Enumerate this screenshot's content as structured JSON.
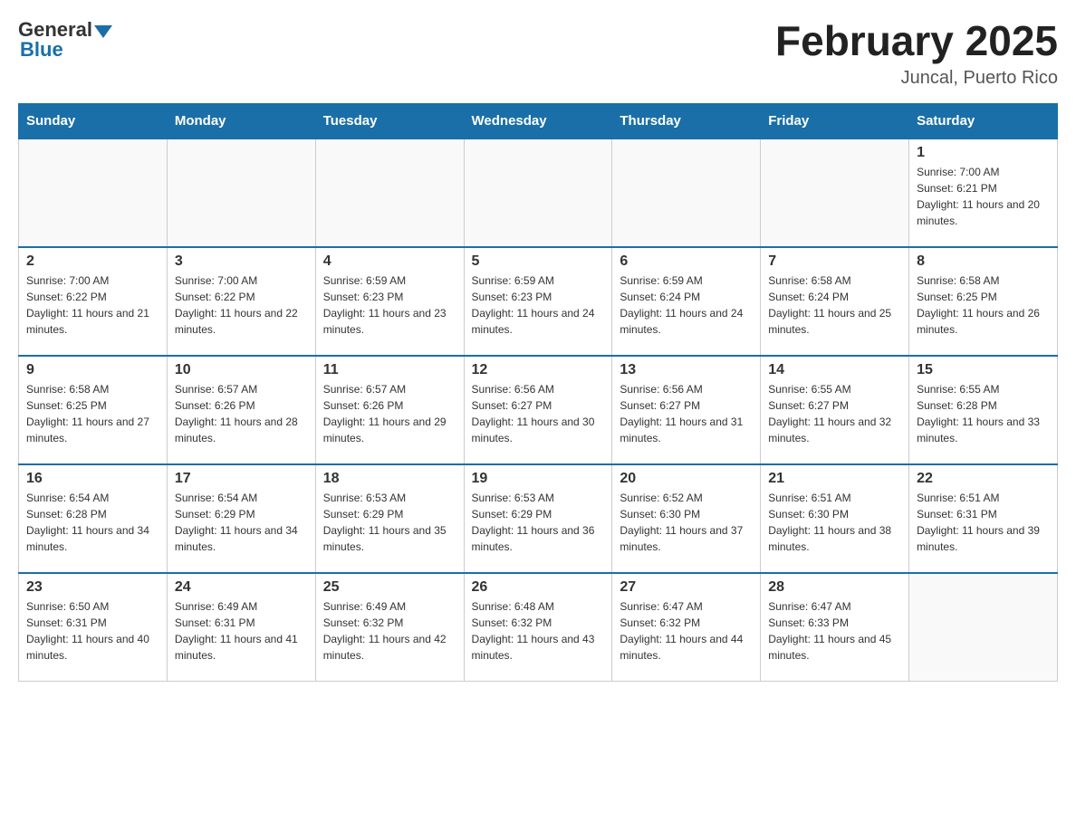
{
  "header": {
    "logo_general": "General",
    "logo_blue": "Blue",
    "title": "February 2025",
    "location": "Juncal, Puerto Rico"
  },
  "days_of_week": [
    "Sunday",
    "Monday",
    "Tuesday",
    "Wednesday",
    "Thursday",
    "Friday",
    "Saturday"
  ],
  "weeks": [
    [
      {
        "day": "",
        "sunrise": "",
        "sunset": "",
        "daylight": ""
      },
      {
        "day": "",
        "sunrise": "",
        "sunset": "",
        "daylight": ""
      },
      {
        "day": "",
        "sunrise": "",
        "sunset": "",
        "daylight": ""
      },
      {
        "day": "",
        "sunrise": "",
        "sunset": "",
        "daylight": ""
      },
      {
        "day": "",
        "sunrise": "",
        "sunset": "",
        "daylight": ""
      },
      {
        "day": "",
        "sunrise": "",
        "sunset": "",
        "daylight": ""
      },
      {
        "day": "1",
        "sunrise": "Sunrise: 7:00 AM",
        "sunset": "Sunset: 6:21 PM",
        "daylight": "Daylight: 11 hours and 20 minutes."
      }
    ],
    [
      {
        "day": "2",
        "sunrise": "Sunrise: 7:00 AM",
        "sunset": "Sunset: 6:22 PM",
        "daylight": "Daylight: 11 hours and 21 minutes."
      },
      {
        "day": "3",
        "sunrise": "Sunrise: 7:00 AM",
        "sunset": "Sunset: 6:22 PM",
        "daylight": "Daylight: 11 hours and 22 minutes."
      },
      {
        "day": "4",
        "sunrise": "Sunrise: 6:59 AM",
        "sunset": "Sunset: 6:23 PM",
        "daylight": "Daylight: 11 hours and 23 minutes."
      },
      {
        "day": "5",
        "sunrise": "Sunrise: 6:59 AM",
        "sunset": "Sunset: 6:23 PM",
        "daylight": "Daylight: 11 hours and 24 minutes."
      },
      {
        "day": "6",
        "sunrise": "Sunrise: 6:59 AM",
        "sunset": "Sunset: 6:24 PM",
        "daylight": "Daylight: 11 hours and 24 minutes."
      },
      {
        "day": "7",
        "sunrise": "Sunrise: 6:58 AM",
        "sunset": "Sunset: 6:24 PM",
        "daylight": "Daylight: 11 hours and 25 minutes."
      },
      {
        "day": "8",
        "sunrise": "Sunrise: 6:58 AM",
        "sunset": "Sunset: 6:25 PM",
        "daylight": "Daylight: 11 hours and 26 minutes."
      }
    ],
    [
      {
        "day": "9",
        "sunrise": "Sunrise: 6:58 AM",
        "sunset": "Sunset: 6:25 PM",
        "daylight": "Daylight: 11 hours and 27 minutes."
      },
      {
        "day": "10",
        "sunrise": "Sunrise: 6:57 AM",
        "sunset": "Sunset: 6:26 PM",
        "daylight": "Daylight: 11 hours and 28 minutes."
      },
      {
        "day": "11",
        "sunrise": "Sunrise: 6:57 AM",
        "sunset": "Sunset: 6:26 PM",
        "daylight": "Daylight: 11 hours and 29 minutes."
      },
      {
        "day": "12",
        "sunrise": "Sunrise: 6:56 AM",
        "sunset": "Sunset: 6:27 PM",
        "daylight": "Daylight: 11 hours and 30 minutes."
      },
      {
        "day": "13",
        "sunrise": "Sunrise: 6:56 AM",
        "sunset": "Sunset: 6:27 PM",
        "daylight": "Daylight: 11 hours and 31 minutes."
      },
      {
        "day": "14",
        "sunrise": "Sunrise: 6:55 AM",
        "sunset": "Sunset: 6:27 PM",
        "daylight": "Daylight: 11 hours and 32 minutes."
      },
      {
        "day": "15",
        "sunrise": "Sunrise: 6:55 AM",
        "sunset": "Sunset: 6:28 PM",
        "daylight": "Daylight: 11 hours and 33 minutes."
      }
    ],
    [
      {
        "day": "16",
        "sunrise": "Sunrise: 6:54 AM",
        "sunset": "Sunset: 6:28 PM",
        "daylight": "Daylight: 11 hours and 34 minutes."
      },
      {
        "day": "17",
        "sunrise": "Sunrise: 6:54 AM",
        "sunset": "Sunset: 6:29 PM",
        "daylight": "Daylight: 11 hours and 34 minutes."
      },
      {
        "day": "18",
        "sunrise": "Sunrise: 6:53 AM",
        "sunset": "Sunset: 6:29 PM",
        "daylight": "Daylight: 11 hours and 35 minutes."
      },
      {
        "day": "19",
        "sunrise": "Sunrise: 6:53 AM",
        "sunset": "Sunset: 6:29 PM",
        "daylight": "Daylight: 11 hours and 36 minutes."
      },
      {
        "day": "20",
        "sunrise": "Sunrise: 6:52 AM",
        "sunset": "Sunset: 6:30 PM",
        "daylight": "Daylight: 11 hours and 37 minutes."
      },
      {
        "day": "21",
        "sunrise": "Sunrise: 6:51 AM",
        "sunset": "Sunset: 6:30 PM",
        "daylight": "Daylight: 11 hours and 38 minutes."
      },
      {
        "day": "22",
        "sunrise": "Sunrise: 6:51 AM",
        "sunset": "Sunset: 6:31 PM",
        "daylight": "Daylight: 11 hours and 39 minutes."
      }
    ],
    [
      {
        "day": "23",
        "sunrise": "Sunrise: 6:50 AM",
        "sunset": "Sunset: 6:31 PM",
        "daylight": "Daylight: 11 hours and 40 minutes."
      },
      {
        "day": "24",
        "sunrise": "Sunrise: 6:49 AM",
        "sunset": "Sunset: 6:31 PM",
        "daylight": "Daylight: 11 hours and 41 minutes."
      },
      {
        "day": "25",
        "sunrise": "Sunrise: 6:49 AM",
        "sunset": "Sunset: 6:32 PM",
        "daylight": "Daylight: 11 hours and 42 minutes."
      },
      {
        "day": "26",
        "sunrise": "Sunrise: 6:48 AM",
        "sunset": "Sunset: 6:32 PM",
        "daylight": "Daylight: 11 hours and 43 minutes."
      },
      {
        "day": "27",
        "sunrise": "Sunrise: 6:47 AM",
        "sunset": "Sunset: 6:32 PM",
        "daylight": "Daylight: 11 hours and 44 minutes."
      },
      {
        "day": "28",
        "sunrise": "Sunrise: 6:47 AM",
        "sunset": "Sunset: 6:33 PM",
        "daylight": "Daylight: 11 hours and 45 minutes."
      },
      {
        "day": "",
        "sunrise": "",
        "sunset": "",
        "daylight": ""
      }
    ]
  ]
}
